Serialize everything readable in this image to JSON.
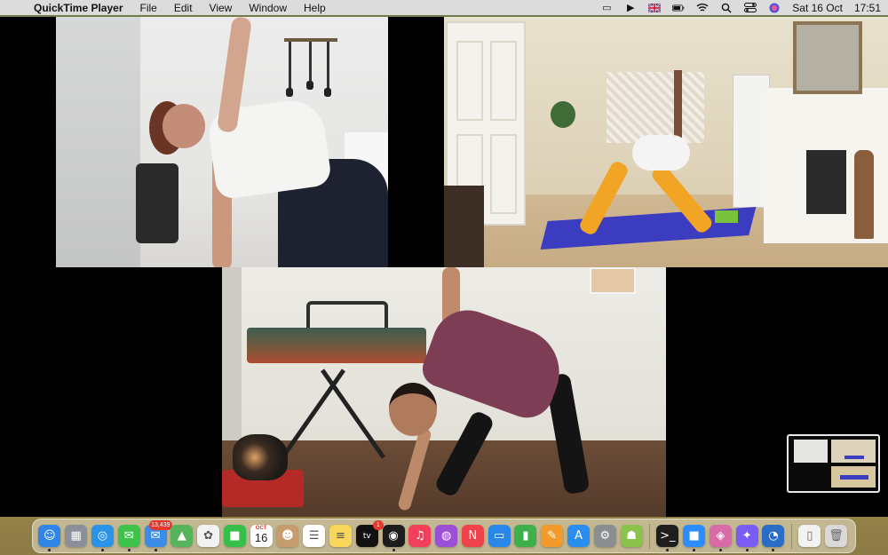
{
  "menubar": {
    "app_name": "QuickTime Player",
    "menus": [
      "File",
      "Edit",
      "View",
      "Window",
      "Help"
    ],
    "status_icons": [
      "screen-mirroring-icon",
      "play-icon",
      "uk-flag-icon",
      "battery-icon",
      "wifi-icon",
      "search-icon",
      "control-center-icon",
      "siri-icon"
    ],
    "clock_date": "Sat 16 Oct",
    "clock_time": "17:51"
  },
  "dock": {
    "calendar_month": "OCT",
    "calendar_day": "16",
    "mail_badge": "13,439",
    "tv_badge": "1",
    "tv_label": "tv",
    "apps": [
      {
        "name": "finder",
        "glyph": "☺",
        "color": "#2f86e6",
        "running": true
      },
      {
        "name": "launchpad",
        "glyph": "▦",
        "color": "#8a8f99",
        "running": false
      },
      {
        "name": "safari",
        "glyph": "◎",
        "color": "#2a93e8",
        "running": true
      },
      {
        "name": "messages",
        "glyph": "✉",
        "color": "#3fc24a",
        "running": true
      },
      {
        "name": "mail",
        "glyph": "✉",
        "color": "#3a8ee8",
        "running": true
      },
      {
        "name": "maps",
        "glyph": "▲",
        "color": "#57b35c",
        "running": false
      },
      {
        "name": "photos",
        "glyph": "✿",
        "color": "#f2f2f2",
        "running": false
      },
      {
        "name": "facetime",
        "glyph": "■",
        "color": "#36c04a",
        "running": false
      },
      {
        "name": "calendar",
        "glyph": "",
        "color": "#ffffff",
        "running": false
      },
      {
        "name": "contacts",
        "glyph": "☻",
        "color": "#c69c6d",
        "running": false
      },
      {
        "name": "reminders",
        "glyph": "☰",
        "color": "#ffffff",
        "running": false
      },
      {
        "name": "notes",
        "glyph": "≡",
        "color": "#f7d65a",
        "running": false
      },
      {
        "name": "apple-tv",
        "glyph": "",
        "color": "#111111",
        "running": false
      },
      {
        "name": "quicktime",
        "glyph": "◉",
        "color": "#1c1c1e",
        "running": true
      },
      {
        "name": "music",
        "glyph": "♫",
        "color": "#f2405a",
        "running": false
      },
      {
        "name": "podcasts",
        "glyph": "◍",
        "color": "#9b4fd6",
        "running": false
      },
      {
        "name": "news",
        "glyph": "N",
        "color": "#f0424b",
        "running": false
      },
      {
        "name": "keynote",
        "glyph": "▭",
        "color": "#2a86e8",
        "running": false
      },
      {
        "name": "numbers",
        "glyph": "▮",
        "color": "#3cb04a",
        "running": false
      },
      {
        "name": "pages",
        "glyph": "✎",
        "color": "#f29a2a",
        "running": false
      },
      {
        "name": "app-store",
        "glyph": "A",
        "color": "#2a8ef0",
        "running": false
      },
      {
        "name": "system-preferences",
        "glyph": "⚙",
        "color": "#8a8d92",
        "running": false
      },
      {
        "name": "android-file-transfer",
        "glyph": "☗",
        "color": "#8bc34a",
        "running": false
      },
      {
        "name": "terminal",
        "glyph": ">_",
        "color": "#1e1e1e",
        "running": true
      },
      {
        "name": "zoom",
        "glyph": "■",
        "color": "#2d8cff",
        "running": true
      },
      {
        "name": "screenshot",
        "glyph": "◈",
        "color": "#d96ba8",
        "running": true
      },
      {
        "name": "messenger",
        "glyph": "✦",
        "color": "#7a5cf5",
        "running": true
      },
      {
        "name": "quicktime-preview",
        "glyph": "◔",
        "color": "#2b6cc4",
        "running": true
      }
    ],
    "right_items": [
      {
        "name": "document",
        "glyph": "▯",
        "color": "#f2f2f2"
      },
      {
        "name": "trash",
        "glyph": "🗑",
        "color": "#d9d9d9"
      }
    ]
  }
}
